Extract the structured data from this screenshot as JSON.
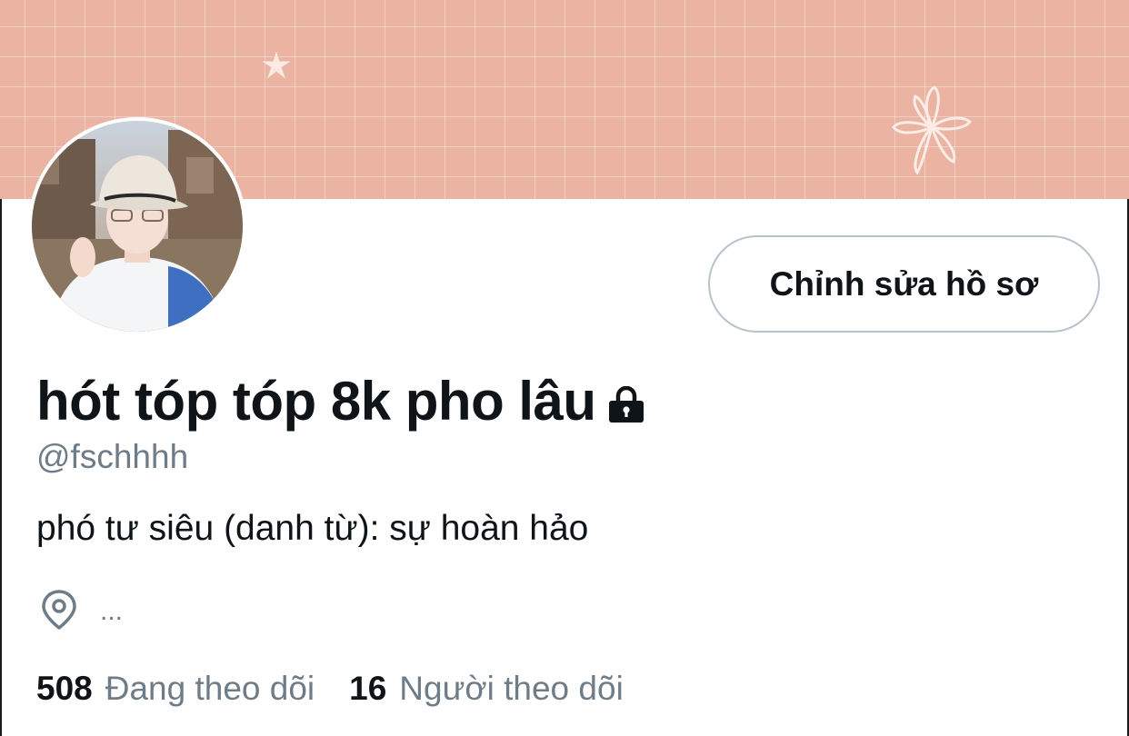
{
  "profile": {
    "display_name": "hót tóp tóp 8k pho lâu",
    "handle": "@fschhhh",
    "bio": "phó tư siêu (danh từ): sự hoàn hảo",
    "location": "...",
    "edit_button_label": "Chỉnh sửa hồ sơ",
    "protected_icon": "lock-icon",
    "location_icon": "map-pin-icon"
  },
  "stats": {
    "following_count": "508",
    "following_label": "Đang theo dõi",
    "followers_count": "16",
    "followers_label": "Người theo dõi"
  },
  "colors": {
    "banner": "#eab3a2",
    "text_primary": "#0f1419",
    "text_secondary": "#6e7c88",
    "button_border": "#b8c2cc"
  }
}
